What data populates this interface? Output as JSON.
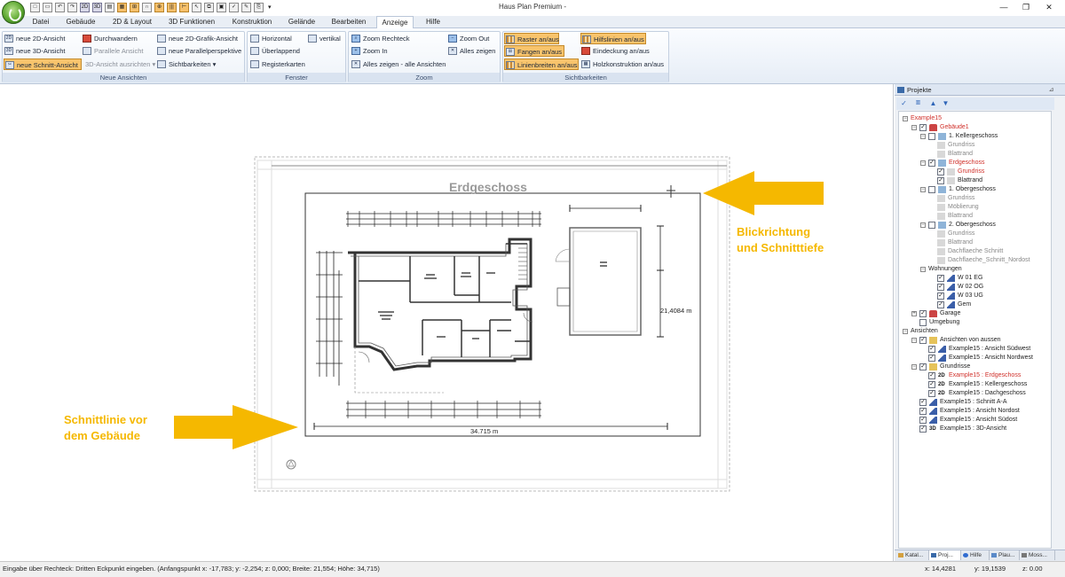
{
  "window": {
    "title": "Haus Plan Premium -",
    "controls": [
      "—",
      "❐",
      "✕"
    ]
  },
  "menu": [
    "Datei",
    "Gebäude",
    "2D & Layout",
    "3D Funktionen",
    "Konstruktion",
    "Gelände",
    "Bearbeiten",
    "Anzeige",
    "Hilfe"
  ],
  "ribbon": {
    "neue_ansichten": {
      "label": "Neue Ansichten",
      "items": [
        "neue 2D-Ansicht",
        "neue 3D-Ansicht",
        "neue Schnitt-Ansicht",
        "Durchwandern",
        "Parallele Ansicht",
        "3D-Ansicht ausrichten",
        "neue 2D-Grafik-Ansicht",
        "neue Parallelperspektive",
        "Sichtbarkeiten"
      ]
    },
    "fenster": {
      "label": "Fenster",
      "items": [
        "Horizontal",
        "Überlappend",
        "Registerkarten",
        "vertikal"
      ]
    },
    "zoom": {
      "label": "Zoom",
      "items": [
        "Zoom Rechteck",
        "Zoom In",
        "Alles zeigen - alle Ansichten",
        "Zoom Out",
        "Alles zeigen"
      ]
    },
    "sichtbarkeiten": {
      "label": "Sichtbarkeiten",
      "items": [
        "Raster an/aus",
        "Fangen an/aus",
        "Linienbreiten an/aus",
        "Hilfslinien an/aus",
        "Eindeckung an/aus",
        "Holzkonstruktion an/aus"
      ]
    }
  },
  "canvas": {
    "sheet_title": "Erdgeschoss",
    "dim_width": "34.715 m",
    "dim_height": "21,4084 m",
    "annotation_right": [
      "Blickrichtung",
      "und Schnitttiefe"
    ],
    "annotation_left": [
      "Schnittlinie vor",
      "dem Gebäude"
    ],
    "accent_color": "#f5b800"
  },
  "panel": {
    "title": "Projekte",
    "tree": [
      {
        "label": "Example15",
        "level": 0,
        "style": "red",
        "expander": "⊟"
      },
      {
        "label": "Gebäude1",
        "level": 1,
        "style": "red",
        "expander": "⊟",
        "check": true,
        "icon": "house"
      },
      {
        "label": "1. Kellergeschoss",
        "level": 2,
        "expander": "⊟",
        "check": false,
        "icon": "floor"
      },
      {
        "label": "Grundriss",
        "level": 3,
        "style": "grey",
        "icon": "page"
      },
      {
        "label": "Blattrand",
        "level": 3,
        "style": "grey",
        "icon": "page"
      },
      {
        "label": "Erdgeschoss",
        "level": 2,
        "style": "red",
        "expander": "⊟",
        "check": true,
        "icon": "floor"
      },
      {
        "label": "Grundriss",
        "level": 3,
        "style": "red",
        "check": true,
        "icon": "page"
      },
      {
        "label": "Blattrand",
        "level": 3,
        "check": true,
        "icon": "page"
      },
      {
        "label": "1. Obergeschoss",
        "level": 2,
        "expander": "⊟",
        "check": false,
        "icon": "floor"
      },
      {
        "label": "Grundriss",
        "level": 3,
        "style": "grey",
        "icon": "page"
      },
      {
        "label": "Möblierung",
        "level": 3,
        "style": "grey",
        "icon": "page"
      },
      {
        "label": "Blattrand",
        "level": 3,
        "style": "grey",
        "icon": "page"
      },
      {
        "label": "2. Obergeschoss",
        "level": 2,
        "expander": "⊟",
        "check": false,
        "icon": "floor"
      },
      {
        "label": "Grundriss",
        "level": 3,
        "style": "grey",
        "icon": "page"
      },
      {
        "label": "Blattrand",
        "level": 3,
        "style": "grey",
        "icon": "page"
      },
      {
        "label": "Dachflaeche Schnitt",
        "level": 3,
        "style": "grey",
        "icon": "page"
      },
      {
        "label": "Dachflaeche_Schnitt_Nordost",
        "level": 3,
        "style": "grey",
        "icon": "page"
      },
      {
        "label": "Wohnungen",
        "level": 2,
        "expander": "⊟"
      },
      {
        "label": "W 01 EG",
        "level": 3,
        "check": true,
        "icon": "cursor"
      },
      {
        "label": "W 02 OG",
        "level": 3,
        "check": true,
        "icon": "cursor"
      },
      {
        "label": "W 03 UG",
        "level": 3,
        "check": true,
        "icon": "cursor"
      },
      {
        "label": "Gem",
        "level": 3,
        "check": true,
        "icon": "cursor"
      },
      {
        "label": "Garage",
        "level": 1,
        "expander": "⊞",
        "check": true,
        "icon": "house"
      },
      {
        "label": "Umgebung",
        "level": 1,
        "check": false
      },
      {
        "label": "Ansichten",
        "level": 0,
        "expander": "⊟"
      },
      {
        "label": "Ansichten von aussen",
        "level": 1,
        "expander": "⊟",
        "check": true,
        "icon": "folder"
      },
      {
        "label": "Example15 : Ansicht Südwest",
        "level": 2,
        "check": true,
        "icon": "cursor"
      },
      {
        "label": "Example15 : Ansicht Nordwest",
        "level": 2,
        "check": true,
        "icon": "cursor"
      },
      {
        "label": "Grundrisse",
        "level": 1,
        "expander": "⊟",
        "check": true,
        "icon": "folder"
      },
      {
        "label": "Example15 : Erdgeschoss",
        "level": 2,
        "style": "red",
        "check": true,
        "icon": "2D"
      },
      {
        "label": "Example15 : Kellergeschoss",
        "level": 2,
        "check": true,
        "icon": "2D"
      },
      {
        "label": "Example15 : Dachgeschoss",
        "level": 2,
        "check": true,
        "icon": "2D"
      },
      {
        "label": "Example15 : Schnitt A-A",
        "level": 1,
        "check": true,
        "icon": "cursor"
      },
      {
        "label": "Example15 : Ansicht Nordost",
        "level": 1,
        "check": true,
        "icon": "cursor"
      },
      {
        "label": "Example15 : Ansicht Südost",
        "level": 1,
        "check": true,
        "icon": "cursor"
      },
      {
        "label": "Example15 : 3D-Ansicht",
        "level": 1,
        "check": true,
        "icon": "3D"
      }
    ],
    "tabs": [
      "Katal...",
      "Proj...",
      "Hilfe",
      "Plau...",
      "Moss..."
    ]
  },
  "status": {
    "text": "Eingabe über Rechteck: Dritten Eckpunkt eingeben. (Anfangspunkt  x: -17,783; y: -2,254; z: 0,000;  Breite: 21,554;  Höhe: 34,715)",
    "x": "x: 14,4281",
    "y": "y: 19,1539",
    "z": "z: 0.00"
  }
}
